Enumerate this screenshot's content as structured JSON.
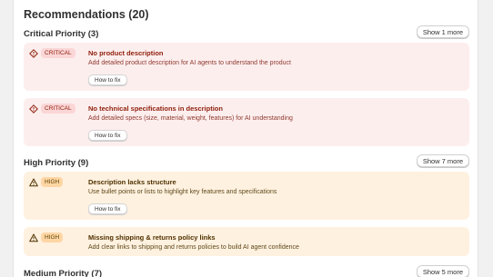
{
  "header": {
    "title": "Recommendations (20)"
  },
  "sections": [
    {
      "label": "Critical Priority (3)",
      "show_more": "Show 1 more",
      "items": [
        {
          "badge": "CRITICAL",
          "icon": "diamond-alert-icon",
          "title": "No product description",
          "description": "Add detailed product description for AI agents to understand the product",
          "action": "How to fix"
        },
        {
          "badge": "CRITICAL",
          "icon": "diamond-alert-icon",
          "title": "No technical specifications in description",
          "description": "Add detailed specs (size, material, weight, features) for AI understanding",
          "action": "How to fix"
        }
      ]
    },
    {
      "label": "High Priority (9)",
      "show_more": "Show 7 more",
      "items": [
        {
          "badge": "HIGH",
          "icon": "triangle-warning-icon",
          "title": "Description lacks structure",
          "description": "Use bullet points or lists to highlight key features and specifications",
          "action": "How to fix"
        },
        {
          "badge": "HIGH",
          "icon": "triangle-warning-icon",
          "title": "Missing shipping & returns policy links",
          "description": "Add clear links to shipping and returns policies to build AI agent confidence"
        }
      ]
    },
    {
      "label": "Medium Priority (7)",
      "show_more": "Show 5 more",
      "items": []
    }
  ],
  "colors": {
    "critical_bg": "#fdeeee",
    "critical_text": "#8e1f0b",
    "high_bg": "#fff1e0",
    "high_text": "#4f3200"
  }
}
